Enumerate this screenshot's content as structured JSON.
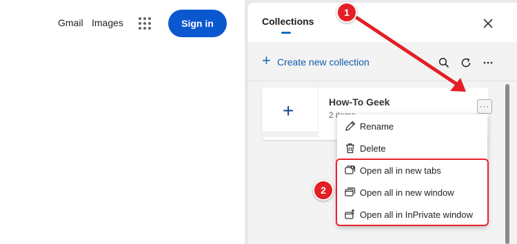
{
  "google": {
    "gmail_label": "Gmail",
    "images_label": "Images",
    "signin_label": "Sign in",
    "apps_icon": "apps-grid-icon"
  },
  "collections": {
    "title": "Collections",
    "close_icon": "close-icon",
    "create_label": "Create new collection",
    "toolbar_icons": [
      "search-icon",
      "refresh-icon",
      "more-icon"
    ],
    "card": {
      "title": "How-To Geek",
      "subtitle": "2 items",
      "more_label": "···"
    },
    "menu": [
      {
        "label": "Rename",
        "icon": "rename-icon"
      },
      {
        "label": "Delete",
        "icon": "delete-icon"
      },
      {
        "label": "Open all in new tabs",
        "icon": "open-tabs-icon"
      },
      {
        "label": "Open all in new window",
        "icon": "open-window-icon"
      },
      {
        "label": "Open all in InPrivate window",
        "icon": "inprivate-window-icon"
      }
    ]
  },
  "annotations": {
    "step1": "1",
    "step2": "2",
    "color": "#e41f26"
  },
  "colors": {
    "accent": "#0f6cbd",
    "signin_bg": "#0b57d0"
  }
}
